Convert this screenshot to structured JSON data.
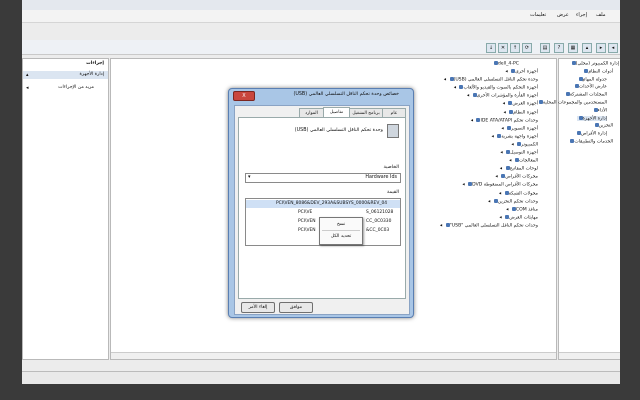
{
  "menubar": {
    "items": [
      "ملف",
      "إجراء",
      "عرض",
      "تعليمات"
    ]
  },
  "actions": {
    "header": "إجراءات",
    "section": "إدارة الأجهزة",
    "more": "مزيد من الإجراءات"
  },
  "tree": {
    "items": [
      "إدارة الكمبيوتر (محلي)",
      "أدوات النظام",
      "جدولة المهام",
      "عارض الأحداث",
      "المجلدات المشتركة",
      "المستخدمين والمجموعات المحلية",
      "الأداء",
      "إدارة الأجهزة",
      "التخزين",
      "إدارة الأقراص",
      "الخدمات والتطبيقات"
    ]
  },
  "devices": {
    "root": "dell_4-PC",
    "items": [
      "أجهزة أخرى",
      "وحدة تحكم الناقل التسلسلي العالمي (USB)",
      "أجهزة التحكم بالصوت والفيديو والألعاب",
      "أجهزة الفأرة والمؤشرات الأخرى",
      "أجهزة العرض",
      "أجهزة النظام",
      "وحدات تحكم IDE ATA/ATAPI",
      "أجهزة التصوير",
      "أجهزة واجهة بشرية",
      "الكمبيوتر",
      "أجهزة التوصيل",
      "المعالجات",
      "لوحات المفاتيح",
      "محركات الأقراص",
      "محركات الأقراص المضغوطة DVD",
      "محولات الشبكة",
      "وحدات تحكم التخزين",
      "منافذ COM",
      "مهايئات العرض",
      "وحدات تحكم الناقل التسلسلي العالمي \"USB\""
    ]
  },
  "dialog": {
    "title": "خصائص وحدة تحكم الناقل التسلسلي العالمي (USB)",
    "close_label": "X",
    "tabs": [
      "عام",
      "برنامج التشغيل",
      "تفاصيل",
      "الموارد"
    ],
    "device_name": "وحدة تحكم الناقل التسلسلي العالمي (USB)",
    "property_label": "الخاصية",
    "property_value": "Hardware Ids",
    "value_label": "القيمة",
    "values": [
      "PCI\\VEN_8086&DEV_293A&SUBSYS_0000&REV_04",
      "PCI\\VEN_8086&DEV_293A&SUBSYS_0000",
      "PCI\\VEN_8086&DEV_293A&CC_0C0320",
      "PCI\\VEN_8086&DEV_293A&CC_0C03"
    ],
    "values_visible": [
      "PCI\\VEN_8086&DEV_293A&SUBSYS_0000&REV_04",
      "PCI\\VE",
      "PCI\\VEN",
      "PCI\\VEN"
    ],
    "values_tail": [
      "",
      "S_06121028",
      "CC_0C0330",
      "&CC_0C03"
    ],
    "context_menu": [
      "نسخ",
      "تحديد الكل"
    ],
    "ok_label": "موافق",
    "cancel_label": "إلغاء الأمر"
  }
}
